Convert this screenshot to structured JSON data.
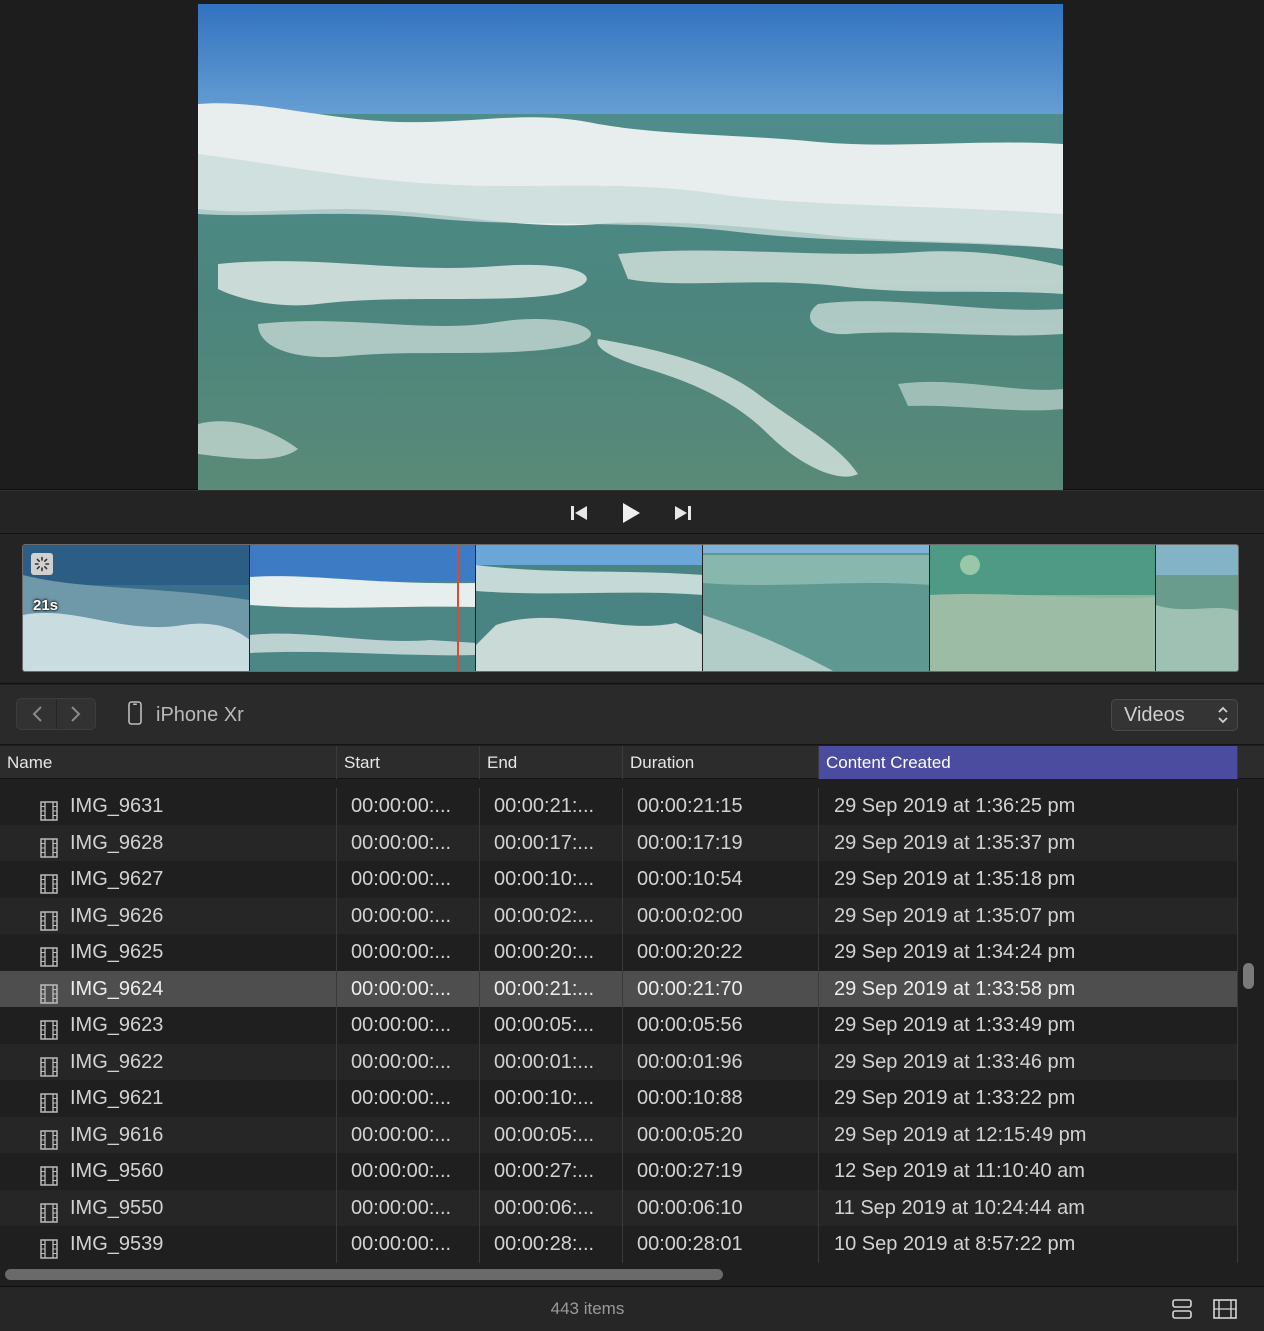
{
  "viewer": {
    "transport": {
      "prev_icon": "skip-back-icon",
      "play_icon": "play-icon",
      "next_icon": "skip-forward-icon"
    }
  },
  "filmstrip": {
    "clip_badge_icon": "loading-spinner-icon",
    "clip_duration": "21s",
    "playhead_color": "#e0492b"
  },
  "browser": {
    "back_icon": "chevron-left-icon",
    "forward_icon": "chevron-right-icon",
    "device_icon": "phone-icon",
    "device_name": "iPhone Xr",
    "media_type": "Videos"
  },
  "table": {
    "columns": [
      "Name",
      "Start",
      "End",
      "Duration",
      "Content Created"
    ],
    "sorted_column": "Content Created",
    "accent": "#4b4ba0",
    "rows": [
      {
        "name": "IMG_9631",
        "start": "00:00:00:...",
        "end": "00:00:21:...",
        "duration": "00:00:21:15",
        "created": "29 Sep 2019 at 1:36:25 pm"
      },
      {
        "name": "IMG_9628",
        "start": "00:00:00:...",
        "end": "00:00:17:...",
        "duration": "00:00:17:19",
        "created": "29 Sep 2019 at 1:35:37 pm"
      },
      {
        "name": "IMG_9627",
        "start": "00:00:00:...",
        "end": "00:00:10:...",
        "duration": "00:00:10:54",
        "created": "29 Sep 2019 at 1:35:18 pm"
      },
      {
        "name": "IMG_9626",
        "start": "00:00:00:...",
        "end": "00:00:02:...",
        "duration": "00:00:02:00",
        "created": "29 Sep 2019 at 1:35:07 pm"
      },
      {
        "name": "IMG_9625",
        "start": "00:00:00:...",
        "end": "00:00:20:...",
        "duration": "00:00:20:22",
        "created": "29 Sep 2019 at 1:34:24 pm"
      },
      {
        "name": "IMG_9624",
        "start": "00:00:00:...",
        "end": "00:00:21:...",
        "duration": "00:00:21:70",
        "created": "29 Sep 2019 at 1:33:58 pm",
        "selected": true
      },
      {
        "name": "IMG_9623",
        "start": "00:00:00:...",
        "end": "00:00:05:...",
        "duration": "00:00:05:56",
        "created": "29 Sep 2019 at 1:33:49 pm"
      },
      {
        "name": "IMG_9622",
        "start": "00:00:00:...",
        "end": "00:00:01:...",
        "duration": "00:00:01:96",
        "created": "29 Sep 2019 at 1:33:46 pm"
      },
      {
        "name": "IMG_9621",
        "start": "00:00:00:...",
        "end": "00:00:10:...",
        "duration": "00:00:10:88",
        "created": "29 Sep 2019 at 1:33:22 pm"
      },
      {
        "name": "IMG_9616",
        "start": "00:00:00:...",
        "end": "00:00:05:...",
        "duration": "00:00:05:20",
        "created": "29 Sep 2019 at 12:15:49 pm"
      },
      {
        "name": "IMG_9560",
        "start": "00:00:00:...",
        "end": "00:00:27:...",
        "duration": "00:00:27:19",
        "created": "12 Sep 2019 at 11:10:40 am"
      },
      {
        "name": "IMG_9550",
        "start": "00:00:00:...",
        "end": "00:00:06:...",
        "duration": "00:00:06:10",
        "created": "11 Sep 2019 at 10:24:44 am"
      },
      {
        "name": "IMG_9539",
        "start": "00:00:00:...",
        "end": "00:00:28:...",
        "duration": "00:00:28:01",
        "created": "10 Sep 2019 at 8:57:22 pm"
      }
    ]
  },
  "status": {
    "item_count": "443 items",
    "list_view_icon": "list-view-icon",
    "filmstrip_view_icon": "filmstrip-view-icon"
  }
}
